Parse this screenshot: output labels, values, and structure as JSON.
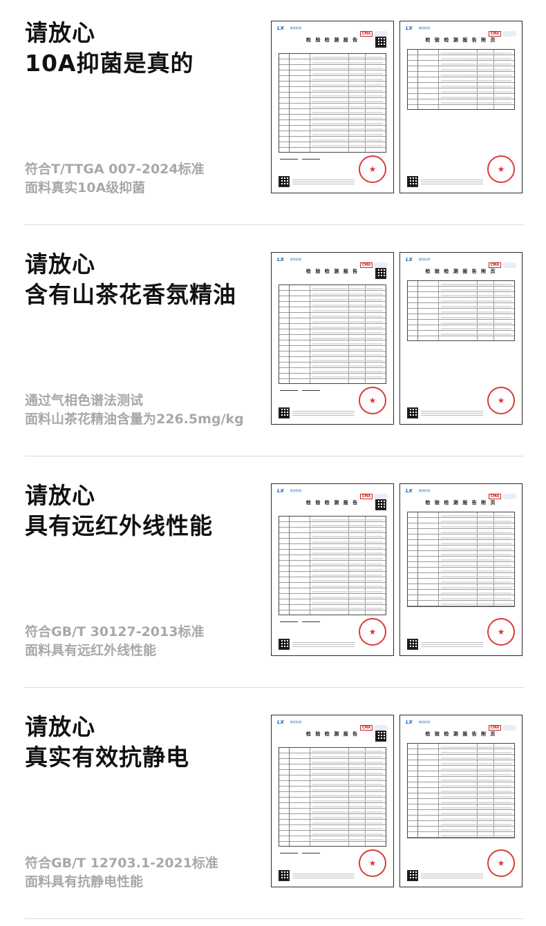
{
  "sections": [
    {
      "headline": [
        "请放心",
        "10A抑菌是真的"
      ],
      "standard": "符合T/TTGA 007-2024标准",
      "description": "面料真实10A级抑菌"
    },
    {
      "headline": [
        "请放心",
        "含有山茶花香氛精油"
      ],
      "standard": "通过气相色谱法测试",
      "description": "面料山茶花精油含量为226.5mg/kg"
    },
    {
      "headline": [
        "请放心",
        "具有远红外线性能"
      ],
      "standard": "符合GB/T 30127-2013标准",
      "description": "面料具有远红外线性能"
    },
    {
      "headline": [
        "请放心",
        "真实有效抗静电"
      ],
      "standard": "符合GB/T 12703.1-2021标准",
      "description": "面料具有抗静电性能"
    }
  ],
  "report": {
    "lab_name": "联合检测",
    "lab_name_en": "LX TESTING",
    "mark_cma": "CMA",
    "title": "检 验 检 测 报 告",
    "appendix_title": "检 验 检 测 报 告 附 页",
    "colors": {
      "logo": "#1d63c4",
      "stamp": "#d93a35"
    }
  },
  "icons": [
    "qr-code-icon",
    "star-stamp-icon",
    "cma-mark-icon",
    "ilac-mark-icon"
  ]
}
